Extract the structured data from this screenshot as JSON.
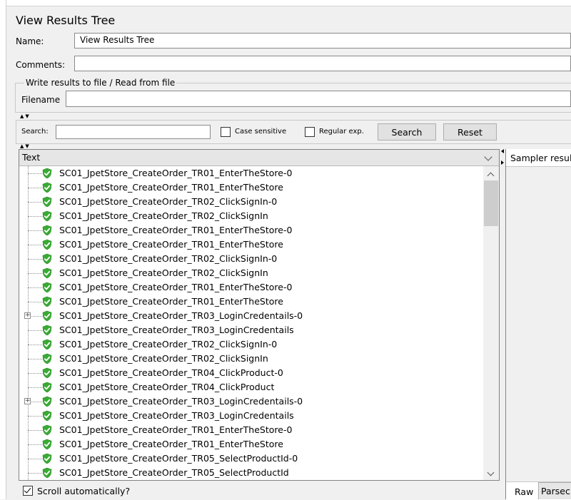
{
  "panel": {
    "title": "View Results Tree",
    "name_label": "Name:",
    "name_value": "View Results Tree",
    "comments_label": "Comments:",
    "comments_value": "",
    "file_section_title": "Write results to file / Read from file",
    "filename_label": "Filename",
    "filename_value": ""
  },
  "search": {
    "label": "Search:",
    "value": "",
    "case_sensitive_label": "Case sensitive",
    "case_sensitive_checked": false,
    "regex_label": "Regular exp.",
    "regex_checked": false,
    "search_button": "Search",
    "reset_button": "Reset"
  },
  "tree": {
    "header": "Text",
    "rows": [
      {
        "label": "SC01_JpetStore_CreateOrder_TR01_EnterTheStore-0",
        "expandable": false
      },
      {
        "label": "SC01_JpetStore_CreateOrder_TR01_EnterTheStore",
        "expandable": false
      },
      {
        "label": "SC01_JpetStore_CreateOrder_TR02_ClickSignIn-0",
        "expandable": false
      },
      {
        "label": "SC01_JpetStore_CreateOrder_TR02_ClickSignIn",
        "expandable": false
      },
      {
        "label": "SC01_JpetStore_CreateOrder_TR01_EnterTheStore-0",
        "expandable": false
      },
      {
        "label": "SC01_JpetStore_CreateOrder_TR01_EnterTheStore",
        "expandable": false
      },
      {
        "label": "SC01_JpetStore_CreateOrder_TR02_ClickSignIn-0",
        "expandable": false
      },
      {
        "label": "SC01_JpetStore_CreateOrder_TR02_ClickSignIn",
        "expandable": false
      },
      {
        "label": "SC01_JpetStore_CreateOrder_TR01_EnterTheStore-0",
        "expandable": false
      },
      {
        "label": "SC01_JpetStore_CreateOrder_TR01_EnterTheStore",
        "expandable": false
      },
      {
        "label": "SC01_JpetStore_CreateOrder_TR03_LoginCredentails-0",
        "expandable": true
      },
      {
        "label": "SC01_JpetStore_CreateOrder_TR03_LoginCredentails",
        "expandable": false
      },
      {
        "label": "SC01_JpetStore_CreateOrder_TR02_ClickSignIn-0",
        "expandable": false
      },
      {
        "label": "SC01_JpetStore_CreateOrder_TR02_ClickSignIn",
        "expandable": false
      },
      {
        "label": "SC01_JpetStore_CreateOrder_TR04_ClickProduct-0",
        "expandable": false
      },
      {
        "label": "SC01_JpetStore_CreateOrder_TR04_ClickProduct",
        "expandable": false
      },
      {
        "label": "SC01_JpetStore_CreateOrder_TR03_LoginCredentails-0",
        "expandable": true
      },
      {
        "label": "SC01_JpetStore_CreateOrder_TR03_LoginCredentails",
        "expandable": false
      },
      {
        "label": "SC01_JpetStore_CreateOrder_TR01_EnterTheStore-0",
        "expandable": false
      },
      {
        "label": "SC01_JpetStore_CreateOrder_TR01_EnterTheStore",
        "expandable": false
      },
      {
        "label": "SC01_JpetStore_CreateOrder_TR05_SelectProductId-0",
        "expandable": false
      },
      {
        "label": "SC01_JpetStore_CreateOrder_TR05_SelectProductId",
        "expandable": false
      }
    ],
    "success_icon": "green-shield-check-icon",
    "scroll_auto_label": "Scroll automatically?",
    "scroll_auto_checked": true
  },
  "result_panel": {
    "header": "Sampler resul",
    "tabs": [
      "Raw",
      "Parsec"
    ]
  },
  "colors": {
    "success_green": "#3aaa35",
    "background": "#f0f0f0"
  }
}
